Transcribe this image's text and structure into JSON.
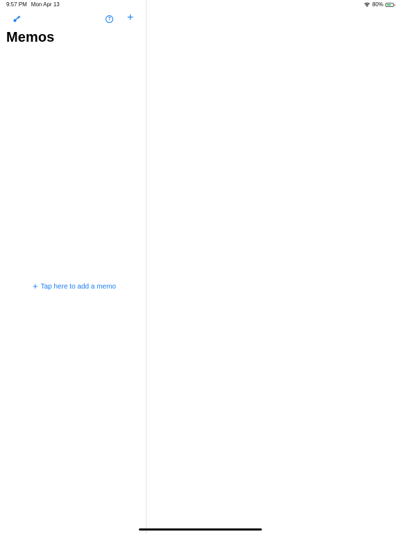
{
  "status": {
    "time": "9:57 PM",
    "date": "Mon Apr 13",
    "battery_percent": "80%",
    "battery_level": 0.8,
    "wifi_icon": "wifi-icon",
    "battery_color": "#34c759"
  },
  "toolbar": {
    "settings_icon": "key-icon",
    "help_icon": "help-icon",
    "help_glyph": "?",
    "add_icon": "plus-icon",
    "add_glyph": "+"
  },
  "sidebar": {
    "title": "Memos",
    "add_memo_glyph": "+",
    "add_memo_label": "Tap here to add a memo"
  },
  "colors": {
    "accent": "#1a7ef2"
  }
}
